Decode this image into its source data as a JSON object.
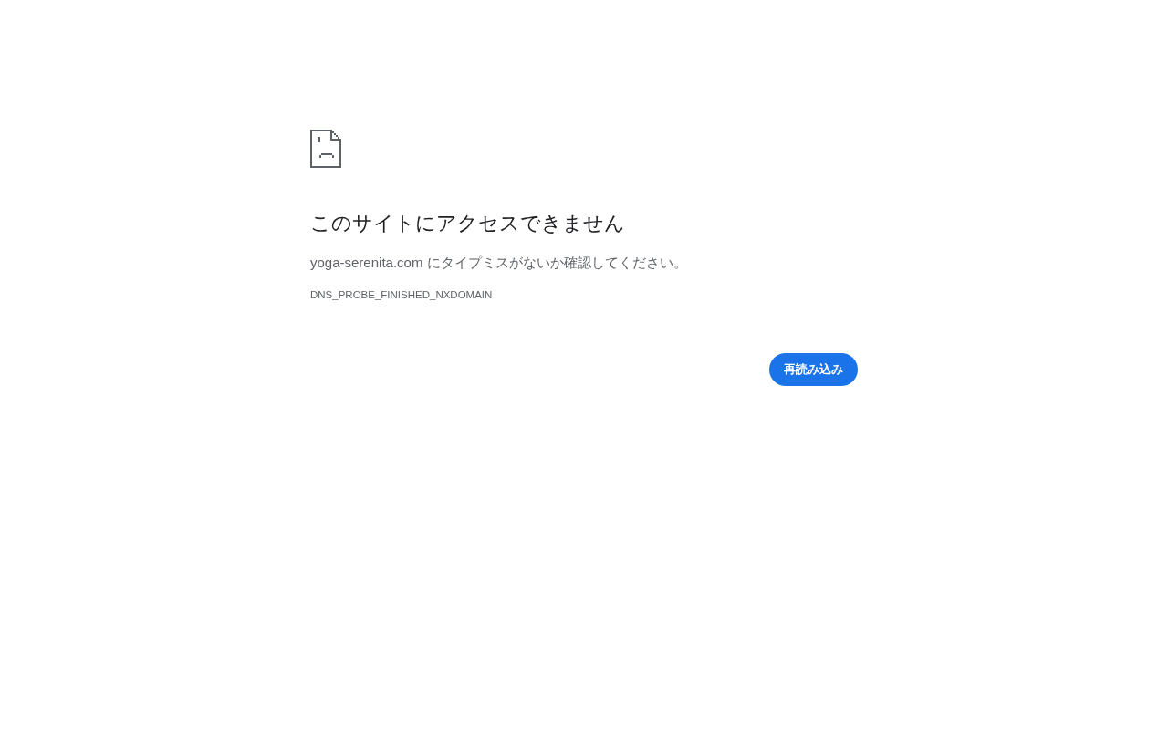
{
  "error_page": {
    "heading": "このサイトにアクセスできません",
    "message": "yoga-serenita.com にタイプミスがないか確認してください。",
    "error_code": "DNS_PROBE_FINISHED_NXDOMAIN",
    "buttons": [
      {
        "label": "再読み込み"
      }
    ]
  }
}
